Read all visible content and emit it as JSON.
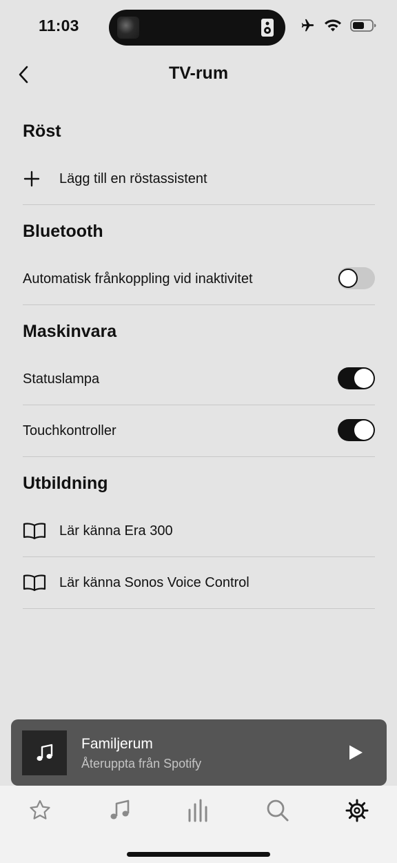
{
  "status_bar": {
    "time": "11:03"
  },
  "header": {
    "title": "TV-rum"
  },
  "sections": {
    "voice": {
      "title": "Röst",
      "add_assistant_label": "Lägg till en röstassistent"
    },
    "bluetooth": {
      "title": "Bluetooth",
      "auto_disconnect_label": "Automatisk frånkoppling vid inaktivitet",
      "auto_disconnect_enabled": false
    },
    "hardware": {
      "title": "Maskinvara",
      "status_light_label": "Statuslampa",
      "status_light_enabled": true,
      "touch_controls_label": "Touchkontroller",
      "touch_controls_enabled": true
    },
    "education": {
      "title": "Utbildning",
      "items": [
        {
          "label": "Lär känna Era 300",
          "icon": "book-icon"
        },
        {
          "label": "Lär känna Sonos Voice Control",
          "icon": "book-icon"
        }
      ]
    }
  },
  "mini_player": {
    "room": "Familjerum",
    "subtitle": "Återuppta från Spotify",
    "art_icon": "music-note-icon",
    "play_icon": "play-icon"
  },
  "tab_bar": {
    "tabs": [
      {
        "icon": "star-icon",
        "active": false
      },
      {
        "icon": "music-note-icon",
        "active": false
      },
      {
        "icon": "equalizer-icon",
        "active": false
      },
      {
        "icon": "search-icon",
        "active": false
      },
      {
        "icon": "gear-icon",
        "active": true
      }
    ]
  },
  "colors": {
    "background": "#e4e4e4",
    "text": "#111111",
    "divider": "#c8c8c8",
    "mini_player_bg": "#555555",
    "tab_bar_bg": "#f2f2f2",
    "inactive_icon": "#8a8a8a"
  }
}
